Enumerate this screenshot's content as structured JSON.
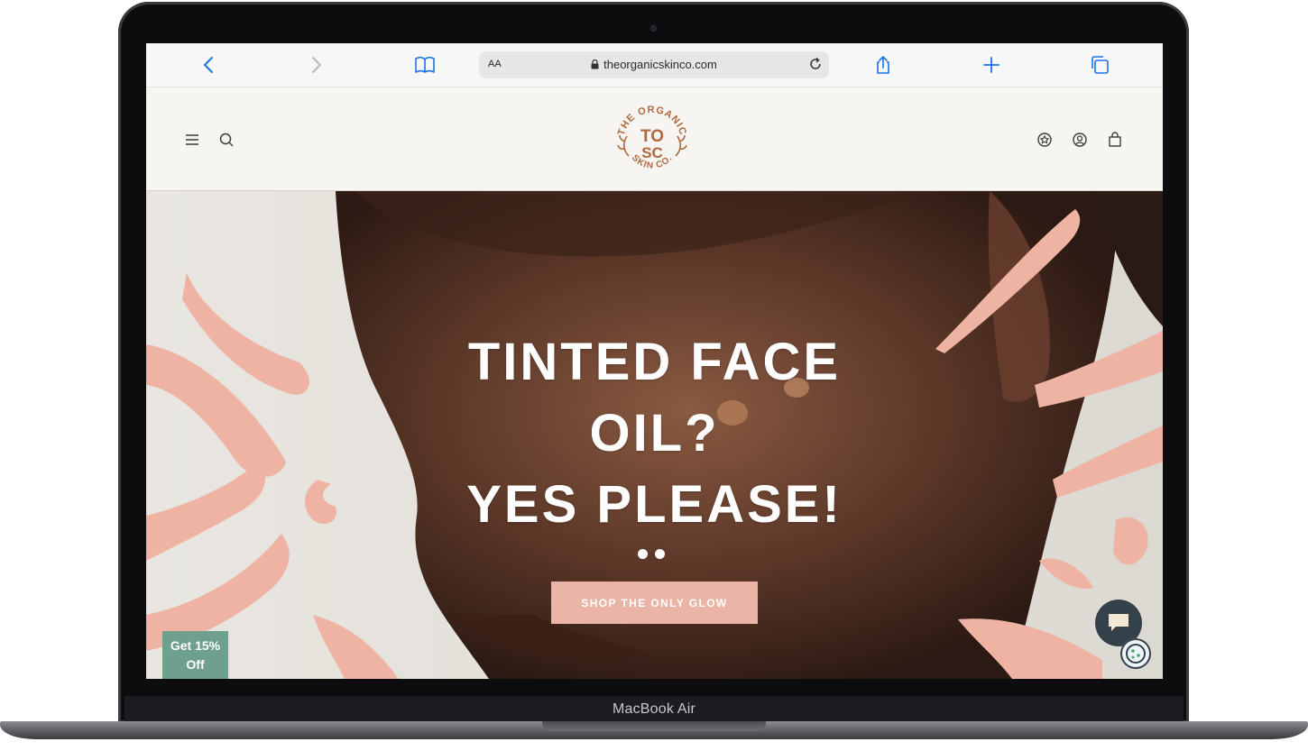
{
  "device": {
    "label": "MacBook Air"
  },
  "browser": {
    "reader_label": "AA",
    "url": "theorganicskinco.com"
  },
  "site": {
    "logo_text": {
      "top": "THE ORGANIC",
      "mark": "TO",
      "mark2": "SC",
      "bottom": "SKIN CO."
    }
  },
  "hero": {
    "headline": [
      "TINTED FACE",
      "OIL?",
      "YES PLEASE!"
    ],
    "cta_label": "SHOP THE ONLY GLOW",
    "slide_count": 2
  },
  "promo": {
    "line1": "Get 15%",
    "line2": "Off"
  },
  "colors": {
    "accent_pink": "#eab5a6",
    "promo_green": "#6f9f8e",
    "logo_brown": "#b2683f",
    "chat_dark": "#34414b"
  },
  "icons": [
    "back-icon",
    "forward-icon",
    "bookmarks-icon",
    "lock-icon",
    "reload-icon",
    "share-icon",
    "new-tab-icon",
    "tabs-icon",
    "menu-icon",
    "search-icon",
    "rewards-icon",
    "account-icon",
    "cart-icon",
    "chat-icon",
    "cookie-icon"
  ]
}
